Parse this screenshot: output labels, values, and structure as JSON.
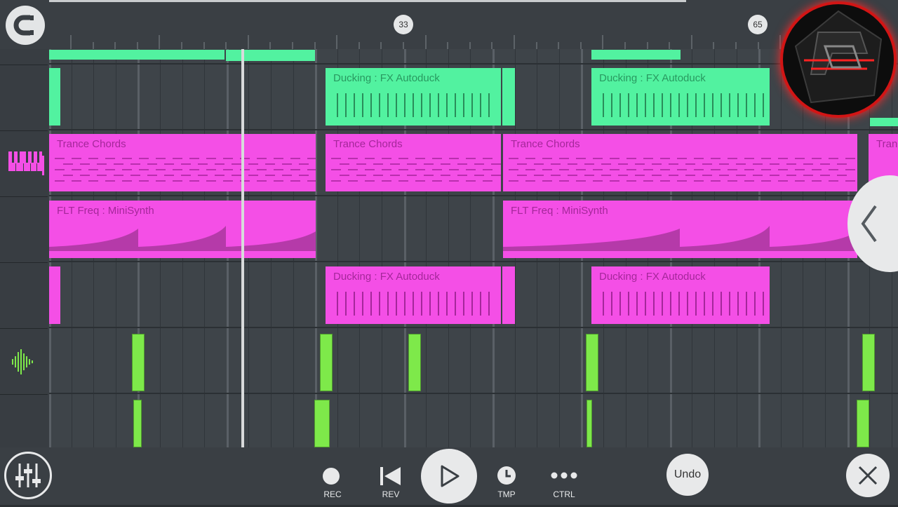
{
  "ruler": {
    "markers": [
      "33",
      "65"
    ]
  },
  "tracks": {
    "clip_labels": {
      "ducking": "Ducking : FX Autoduck",
      "trance": "Trance Chords",
      "trance_cut": "Tran",
      "flt": "FLT Freq : MiniSynth"
    }
  },
  "toolbar": {
    "rec": "REC",
    "rev": "REV",
    "tmp": "TMP",
    "ctrl": "CTRL",
    "undo": "Undo"
  },
  "icons": {
    "magnet": "magnet-icon",
    "piano": "piano-icon",
    "waveform": "waveform-icon",
    "mixer": "mixer-icon",
    "play": "play-icon",
    "close": "close-icon",
    "collapse": "chevron-left-icon"
  },
  "colors": {
    "automation_green": "#52f2a0",
    "pattern_pink": "#f44fe6",
    "audio_lime": "#7ee94a",
    "background": "#2b2f33"
  }
}
